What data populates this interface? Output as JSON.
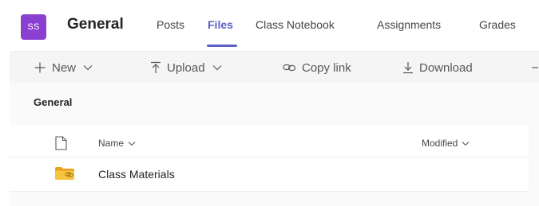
{
  "team": {
    "avatar_initials": "SS",
    "name": "General",
    "avatar_color": "#8b3fd1"
  },
  "tabs": [
    {
      "label": "Posts",
      "active": false
    },
    {
      "label": "Files",
      "active": true
    },
    {
      "label": "Class Notebook",
      "active": false
    },
    {
      "label": "Assignments",
      "active": false
    },
    {
      "label": "Grades",
      "active": false
    }
  ],
  "toolbar": {
    "new_label": "New",
    "upload_label": "Upload",
    "copy_link_label": "Copy link",
    "download_label": "Download"
  },
  "breadcrumb": "General",
  "list": {
    "columns": {
      "name": "Name",
      "modified": "Modified"
    },
    "rows": [
      {
        "name": "Class Materials",
        "type": "folder",
        "modified": ""
      }
    ]
  },
  "colors": {
    "accent": "#5b5fc7",
    "folder": "#f8c340"
  }
}
